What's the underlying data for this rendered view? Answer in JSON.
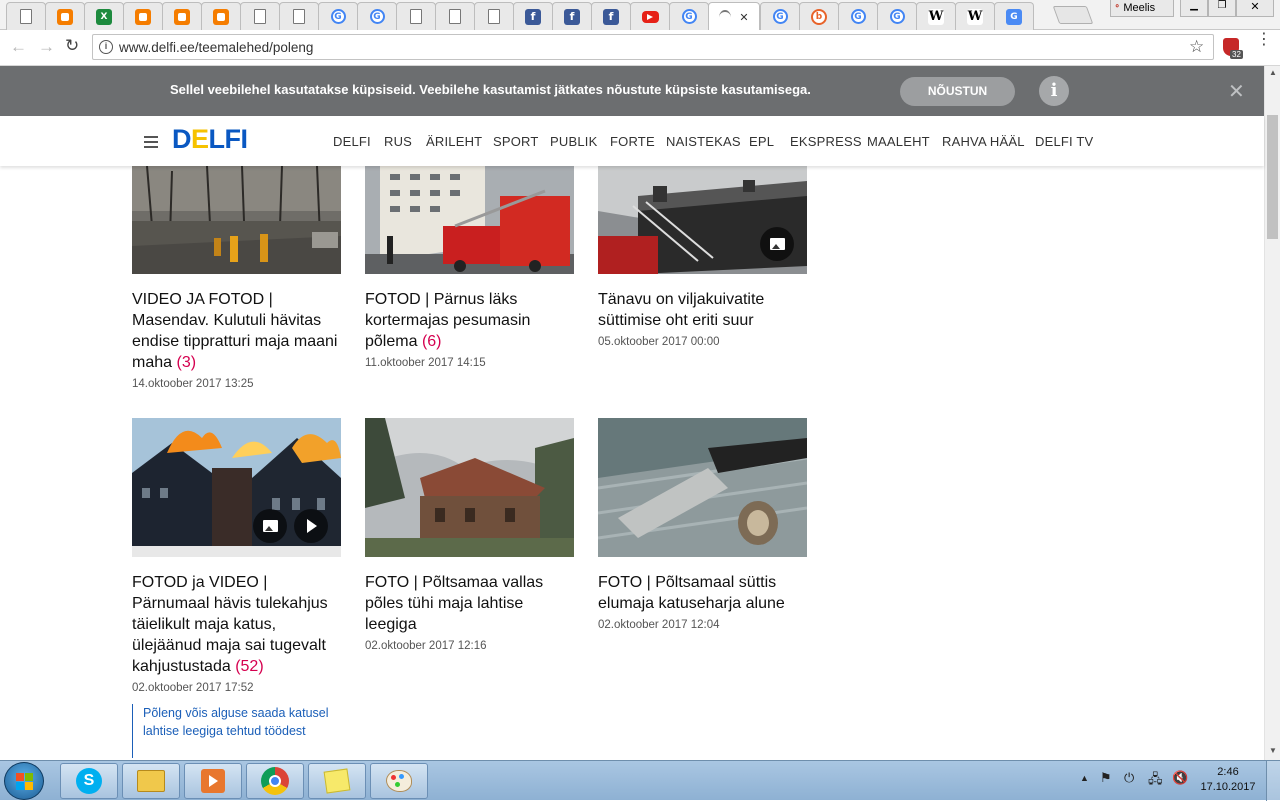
{
  "browser": {
    "tabs": [
      {
        "icon": "doc-icon"
      },
      {
        "icon": "blogger-icon"
      },
      {
        "icon": "excel-icon"
      },
      {
        "icon": "blogger-icon"
      },
      {
        "icon": "blogger-icon"
      },
      {
        "icon": "blogger-icon"
      },
      {
        "icon": "doc-icon"
      },
      {
        "icon": "doc-icon"
      },
      {
        "icon": "google-icon"
      },
      {
        "icon": "google-icon"
      },
      {
        "icon": "doc-icon"
      },
      {
        "icon": "doc-icon"
      },
      {
        "icon": "doc-icon"
      },
      {
        "icon": "facebook-icon"
      },
      {
        "icon": "facebook-icon"
      },
      {
        "icon": "facebook-icon"
      },
      {
        "icon": "youtube-icon"
      },
      {
        "icon": "google-icon"
      },
      {
        "icon": "loading-icon",
        "active": true
      },
      {
        "icon": "google-icon"
      },
      {
        "icon": "bc-icon"
      },
      {
        "icon": "google-icon"
      },
      {
        "icon": "google-icon"
      },
      {
        "icon": "wikipedia-icon"
      },
      {
        "icon": "wikipedia-icon"
      },
      {
        "icon": "translate-icon"
      }
    ],
    "profile_name": "Meelis",
    "url": "www.delfi.ee/teemalehed/poleng",
    "extension_badge": "32"
  },
  "cookie_bar": {
    "text": "Sellel veebilehel kasutatakse küpsiseid. Veebilehe kasutamist jätkates nõustute küpsiste kasutamisega.",
    "accept_label": "NÕUSTUN",
    "info_label": "i",
    "close_label": "✕"
  },
  "site": {
    "logo_d": "D",
    "logo_e": "E",
    "logo_rest": "LFI",
    "nav": [
      "DELFI",
      "RUS",
      "ÄRILEHT",
      "SPORT",
      "PUBLIK",
      "FORTE",
      "NAISTEKAS",
      "EPL",
      "EKSPRESS",
      "MAALEHT",
      "RAHVA HÄÄL",
      "DELFI TV"
    ]
  },
  "articles": [
    {
      "headline": "VIDEO JA FOTOD | Masendav. Kulutuli hävitas endise tippratturi maja maani maha",
      "comments": "(3)",
      "date": "14.oktoober 2017 13:25"
    },
    {
      "headline": "FOTOD | Pärnus läks kortermajas pesumasin põlema",
      "comments": "(6)",
      "date": "11.oktoober 2017 14:15"
    },
    {
      "headline": "Tänavu on viljakuivatite süttimise oht eriti suur",
      "comments": "",
      "date": "05.oktoober 2017 00:00"
    },
    {
      "headline": "FOTOD ja VIDEO | Pärnumaal hävis tulekahjus täielikult maja katus, ülejäänud maja sai tugevalt kahjustustada",
      "comments": "(52)",
      "date": "02.oktoober 2017 17:52",
      "related": "Põleng võis alguse saada katusel lahtise leegiga tehtud töödest"
    },
    {
      "headline": "FOTO | Põltsamaa vallas põles tühi maja lahtise leegiga",
      "comments": "",
      "date": "02.oktoober 2017 12:16"
    },
    {
      "headline": "FOTO | Põltsamaal süttis elumaja katuseharja alune",
      "comments": "",
      "date": "02.oktoober 2017 12:04"
    }
  ],
  "taskbar": {
    "time": "2:46",
    "date": "17.10.2017",
    "apps": [
      "skype-icon",
      "file-explorer-icon",
      "media-player-icon",
      "chrome-icon",
      "sticky-notes-icon",
      "paint-icon"
    ]
  }
}
